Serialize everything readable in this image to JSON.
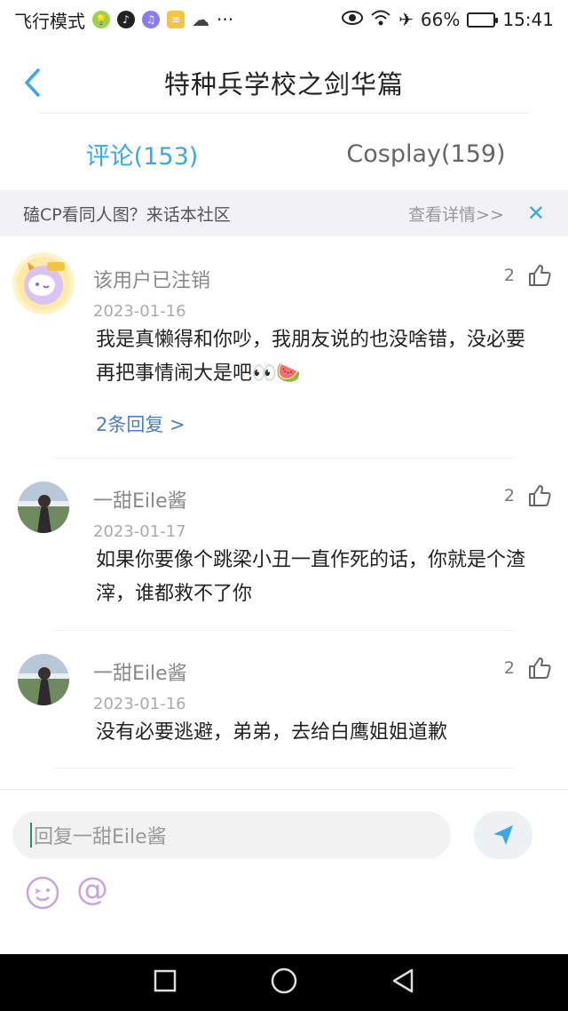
{
  "status_bar": {
    "mode": "飞行模式",
    "dots": "···",
    "battery": "66%",
    "battery_level": 0.66,
    "time": "15:41"
  },
  "header": {
    "title": "特种兵学校之剑华篇"
  },
  "tabs": [
    {
      "label": "评论(153)"
    },
    {
      "label": "Cosplay(159)"
    }
  ],
  "banner": {
    "text": "磕CP看同人图？来话本社区",
    "link": "查看详情>>",
    "close": "✕"
  },
  "comments": [
    {
      "username": "该用户已注销",
      "date": "2023-01-16",
      "text": "我是真懒得和你吵，我朋友说的也没啥错，没必要再把事情闹大是吧👀🍉",
      "likes": "2",
      "replies": "2条回复 >"
    },
    {
      "username": "一甜Eile酱",
      "date": "2023-01-17",
      "text": "如果你要像个跳梁小丑一直作死的话，你就是个渣滓，谁都救不了你",
      "likes": "2"
    },
    {
      "username": "一甜Eile酱",
      "date": "2023-01-16",
      "text": "没有必要逃避，弟弟，去给白鹰姐姐道歉",
      "likes": "2"
    }
  ],
  "reply_bar": {
    "placeholder": "回复一甜Eile酱",
    "at": "@"
  },
  "colors": {
    "accent": "#3aa8e4",
    "link": "#4b7fc2"
  }
}
